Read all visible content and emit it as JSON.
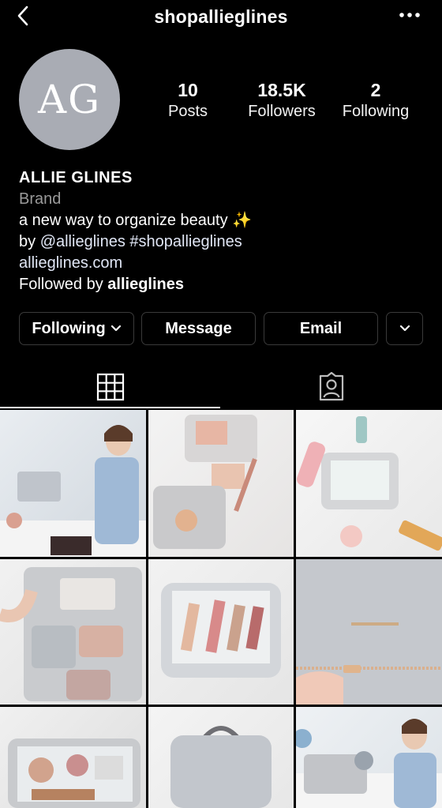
{
  "header": {
    "username": "shopallieglines",
    "back_icon": "chevron-left-icon",
    "more_icon": "more-dots-icon"
  },
  "profile": {
    "avatar_initials": "AG",
    "avatar_color": "#a9acb4",
    "stats": [
      {
        "value": "10",
        "label": "Posts"
      },
      {
        "value": "18.5K",
        "label": "Followers"
      },
      {
        "value": "2",
        "label": "Following"
      }
    ],
    "name": "ALLIE GLINES",
    "category": "Brand",
    "bio_line1": "a new way to organize beauty",
    "bio_emoji": "✨",
    "bio_by": "by",
    "bio_mention": "@allieglines",
    "bio_hashtag": "#shopallieglines",
    "website": "allieglines.com",
    "followed_by_prefix": "Followed by",
    "followed_by_user": "allieglines"
  },
  "actions": {
    "following_label": "Following",
    "message_label": "Message",
    "email_label": "Email"
  },
  "tabs": [
    {
      "icon": "grid-icon",
      "active": true
    },
    {
      "icon": "tagged-icon",
      "active": false
    }
  ],
  "colors": {
    "background": "#000000",
    "button_border": "#3a3a3a",
    "muted": "#9a9a9a"
  }
}
